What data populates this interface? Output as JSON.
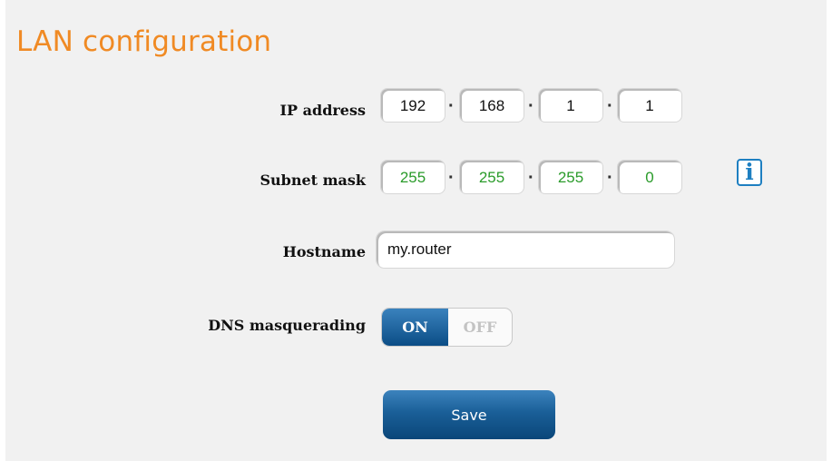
{
  "page": {
    "title": "LAN configuration"
  },
  "fields": {
    "ip_address": {
      "label": "IP address",
      "octets": [
        "192",
        "168",
        "1",
        "1"
      ]
    },
    "subnet_mask": {
      "label": "Subnet mask",
      "octets": [
        "255",
        "255",
        "255",
        "0"
      ]
    },
    "hostname": {
      "label": "Hostname",
      "value": "my.router"
    },
    "dns_masquerading": {
      "label": "DNS masquerading",
      "on_label": "ON",
      "off_label": "OFF",
      "state": "on"
    }
  },
  "info_icon": {
    "icon": "info-icon",
    "glyph": "i"
  },
  "actions": {
    "save_label": "Save"
  },
  "colors": {
    "title": "#f08a24",
    "subnet_value": "#2a9b2a",
    "accent": "#1e7fc1"
  }
}
